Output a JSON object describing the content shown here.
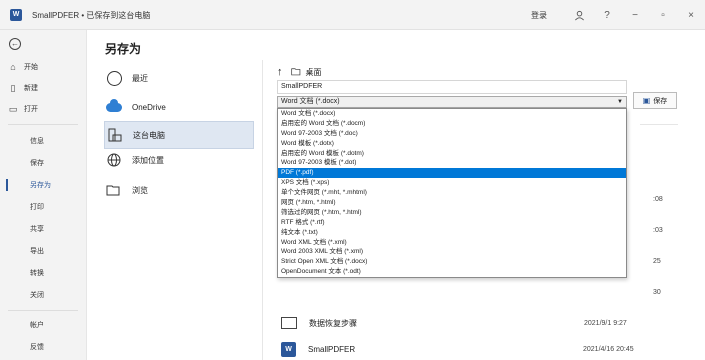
{
  "window": {
    "app_icon": "W",
    "title": "SmallPDFER • 已保存到这台电脑",
    "signin": "登录",
    "controls": [
      "person-icon",
      "?",
      "−",
      "▫",
      "×"
    ]
  },
  "nav": {
    "back_icon": "back-arrow-icon",
    "top_items": [
      {
        "label": "开始",
        "icon": "home-icon"
      },
      {
        "label": "新建",
        "icon": "new-doc-icon"
      },
      {
        "label": "打开",
        "icon": "folder-open-icon"
      }
    ],
    "items": [
      "信息",
      "保存",
      "另存为",
      "打印",
      "共享",
      "导出",
      "转换",
      "关闭"
    ],
    "active": "另存为",
    "bottom_items": [
      "帐户",
      "反馈"
    ]
  },
  "page": {
    "title": "另存为",
    "locations": [
      {
        "label": "最近",
        "icon": "clock-icon"
      },
      {
        "label": "OneDrive",
        "icon": "onedrive-cloud-icon"
      },
      {
        "label": "这台电脑",
        "icon": "computer-icon",
        "selected": true
      },
      {
        "label": "添加位置",
        "icon": "globe-icon"
      },
      {
        "label": "浏览",
        "icon": "folder-icon"
      }
    ]
  },
  "save": {
    "path": "桌面",
    "filename": "SmallPDFER",
    "filetype": "Word 文档 (*.docx)",
    "save_label": "保存",
    "filetypes": [
      "Word 文档 (*.docx)",
      "启用宏的 Word 文档 (*.docm)",
      "Word 97-2003 文档 (*.doc)",
      "Word 模板 (*.dotx)",
      "启用宏的 Word 模板 (*.dotm)",
      "Word 97-2003 模板 (*.dot)",
      "PDF (*.pdf)",
      "XPS 文档 (*.xps)",
      "单个文件网页 (*.mht, *.mhtml)",
      "网页 (*.htm, *.html)",
      "筛选过的网页 (*.htm, *.html)",
      "RTF 格式 (*.rtf)",
      "纯文本 (*.txt)",
      "Word XML 文档 (*.xml)",
      "Word 2003 XML 文档 (*.xml)",
      "Strict Open XML 文档 (*.docx)",
      "OpenDocument 文本 (*.odt)"
    ],
    "selected_filetype": "PDF (*.pdf)",
    "partial_dates": [
      ":08",
      ":03",
      "25",
      "30"
    ],
    "files": [
      {
        "name": "数据恢复步骤",
        "date": "2021/9/1 9:27",
        "icon": "folder-icon"
      },
      {
        "name": "SmallPDFER",
        "date": "2021/4/16 20:45",
        "icon": "word-file-icon"
      }
    ]
  }
}
